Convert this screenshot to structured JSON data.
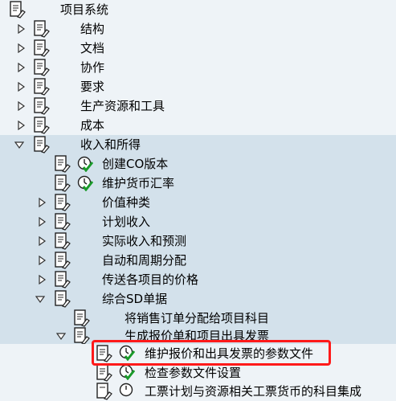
{
  "tree": [
    {
      "label": "项目系统",
      "expander": "none",
      "exec": false
    },
    {
      "label": "结构",
      "expander": "collapsed",
      "exec": false
    },
    {
      "label": "文档",
      "expander": "collapsed",
      "exec": false
    },
    {
      "label": "协作",
      "expander": "collapsed",
      "exec": false
    },
    {
      "label": "要求",
      "expander": "collapsed",
      "exec": false
    },
    {
      "label": "生产资源和工具",
      "expander": "collapsed",
      "exec": false
    },
    {
      "label": "成本",
      "expander": "collapsed",
      "exec": false
    },
    {
      "label": "收入和所得",
      "expander": "expanded",
      "exec": false
    },
    {
      "label": "创建CO版本",
      "expander": "none",
      "exec": true
    },
    {
      "label": "维护货币汇率",
      "expander": "none",
      "exec": true
    },
    {
      "label": "价值种类",
      "expander": "collapsed",
      "exec": false
    },
    {
      "label": "计划收入",
      "expander": "collapsed",
      "exec": false
    },
    {
      "label": "实际收入和预测",
      "expander": "collapsed",
      "exec": false
    },
    {
      "label": "自动和周期分配",
      "expander": "collapsed",
      "exec": false
    },
    {
      "label": "传送各项目的价格",
      "expander": "collapsed",
      "exec": false
    },
    {
      "label": "综合SD单据",
      "expander": "expanded",
      "exec": false
    },
    {
      "label": "将销售订单分配给项目科目",
      "expander": "none",
      "exec": false
    },
    {
      "label": "生成报价单和项目出具发票",
      "expander": "expanded",
      "exec": false
    },
    {
      "label": "维护报价和出具发票的参数文件",
      "expander": "none",
      "exec": true,
      "highlighted": true
    },
    {
      "label": "检查参数文件设置",
      "expander": "none",
      "exec": true
    },
    {
      "label": "工票计划与资源相关工票货币的科目集成",
      "expander": "none",
      "exec": true
    }
  ],
  "colors": {
    "background": "#dfe9f1",
    "highlight_border": "#ff1a1a",
    "check_green": "#1a9a2a",
    "doc_icon": "#ffffff"
  }
}
